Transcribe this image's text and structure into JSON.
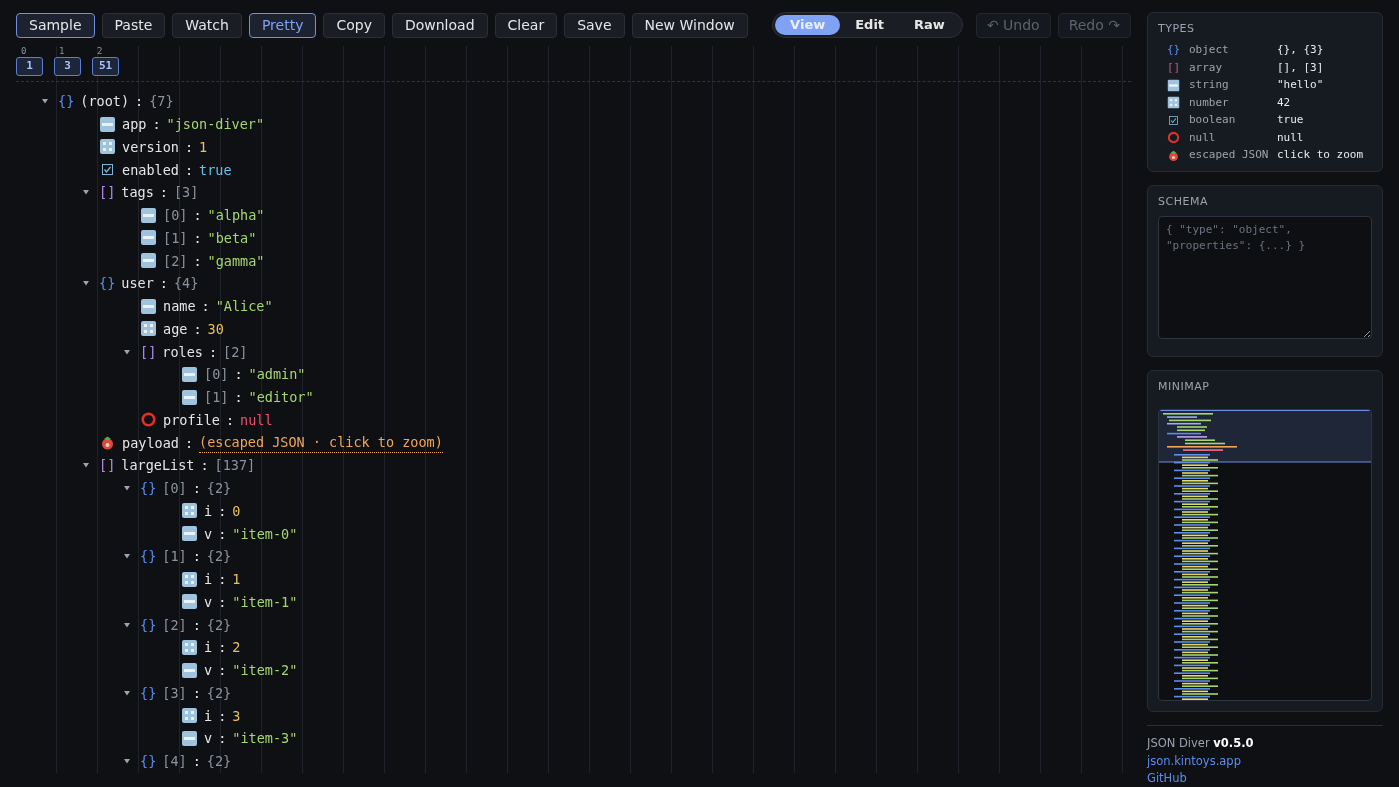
{
  "toolbar": {
    "buttons": [
      {
        "label": "Sample",
        "kind": "outlined"
      },
      {
        "label": "Paste",
        "kind": "plain"
      },
      {
        "label": "Watch",
        "kind": "plain"
      },
      {
        "label": "Pretty",
        "kind": "toggled"
      },
      {
        "label": "Copy",
        "kind": "plain"
      },
      {
        "label": "Download",
        "kind": "plain"
      },
      {
        "label": "Clear",
        "kind": "plain"
      },
      {
        "label": "Save",
        "kind": "plain"
      },
      {
        "label": "New Window",
        "kind": "plain"
      }
    ],
    "modes": [
      {
        "label": "View",
        "selected": true
      },
      {
        "label": "Edit",
        "selected": false
      },
      {
        "label": "Raw",
        "selected": false
      }
    ],
    "history": [
      {
        "label": "↶ Undo",
        "disabled": true
      },
      {
        "label": "Redo ↷",
        "disabled": true
      }
    ]
  },
  "depth_columns": [
    {
      "index": "0",
      "value": "1"
    },
    {
      "index": "1",
      "value": "3"
    },
    {
      "index": "2",
      "value": "51"
    }
  ],
  "tree": {
    "separator": ":",
    "root": {
      "kind": "object",
      "glyph": "{}",
      "key": "(root)",
      "count": "{7}",
      "expanded": true,
      "children": [
        {
          "kind": "string",
          "key": "app",
          "value": "\"json-diver\""
        },
        {
          "kind": "number",
          "key": "version",
          "value": "1"
        },
        {
          "kind": "boolean",
          "key": "enabled",
          "value": "true"
        },
        {
          "kind": "array",
          "glyph": "[]",
          "key": "tags",
          "count": "[3]",
          "expanded": true,
          "children": [
            {
              "kind": "string",
              "key": "[0]",
              "value": "\"alpha\""
            },
            {
              "kind": "string",
              "key": "[1]",
              "value": "\"beta\""
            },
            {
              "kind": "string",
              "key": "[2]",
              "value": "\"gamma\""
            }
          ]
        },
        {
          "kind": "object",
          "glyph": "{}",
          "key": "user",
          "count": "{4}",
          "expanded": true,
          "children": [
            {
              "kind": "string",
              "key": "name",
              "value": "\"Alice\""
            },
            {
              "kind": "number",
              "key": "age",
              "value": "30"
            },
            {
              "kind": "array",
              "glyph": "[]",
              "key": "roles",
              "count": "[2]",
              "expanded": true,
              "children": [
                {
                  "kind": "string",
                  "key": "[0]",
                  "value": "\"admin\""
                },
                {
                  "kind": "string",
                  "key": "[1]",
                  "value": "\"editor\""
                }
              ]
            },
            {
              "kind": "null",
              "key": "profile",
              "value": "null"
            }
          ]
        },
        {
          "kind": "escaped",
          "key": "payload",
          "value": "(escaped JSON · click to zoom)"
        },
        {
          "kind": "array",
          "glyph": "[]",
          "key": "largeList",
          "count": "[137]",
          "expanded": true,
          "children": [
            {
              "kind": "object",
              "glyph": "{}",
              "key": "[0]",
              "count": "{2}",
              "expanded": true,
              "children": [
                {
                  "kind": "number",
                  "key": "i",
                  "value": "0"
                },
                {
                  "kind": "string",
                  "key": "v",
                  "value": "\"item-0\""
                }
              ]
            },
            {
              "kind": "object",
              "glyph": "{}",
              "key": "[1]",
              "count": "{2}",
              "expanded": true,
              "children": [
                {
                  "kind": "number",
                  "key": "i",
                  "value": "1"
                },
                {
                  "kind": "string",
                  "key": "v",
                  "value": "\"item-1\""
                }
              ]
            },
            {
              "kind": "object",
              "glyph": "{}",
              "key": "[2]",
              "count": "{2}",
              "expanded": true,
              "children": [
                {
                  "kind": "number",
                  "key": "i",
                  "value": "2"
                },
                {
                  "kind": "string",
                  "key": "v",
                  "value": "\"item-2\""
                }
              ]
            },
            {
              "kind": "object",
              "glyph": "{}",
              "key": "[3]",
              "count": "{2}",
              "expanded": true,
              "children": [
                {
                  "kind": "number",
                  "key": "i",
                  "value": "3"
                },
                {
                  "kind": "string",
                  "key": "v",
                  "value": "\"item-3\""
                }
              ]
            },
            {
              "kind": "object",
              "glyph": "{}",
              "key": "[4]",
              "count": "{2}",
              "expanded": true
            }
          ]
        }
      ]
    }
  },
  "types_panel": {
    "title": "TYPES",
    "items": [
      {
        "kind": "object",
        "glyph": "{}",
        "name": "object",
        "example": "{}, {3}"
      },
      {
        "kind": "array",
        "glyph": "[]",
        "name": "array",
        "example": "[], [3]"
      },
      {
        "kind": "string",
        "name": "string",
        "example": "\"hello\""
      },
      {
        "kind": "number",
        "name": "number",
        "example": "42"
      },
      {
        "kind": "boolean",
        "name": "boolean",
        "example": "true"
      },
      {
        "kind": "null",
        "name": "null",
        "example": "null"
      },
      {
        "kind": "escaped",
        "name": "escaped JSON",
        "example": "click to zoom"
      }
    ]
  },
  "schema_panel": {
    "title": "SCHEMA",
    "placeholder": "{ \"type\": \"object\", \"properties\": {...} }"
  },
  "minimap_panel": {
    "title": "MINIMAP"
  },
  "footer": {
    "version": "JSON Diver **v0.5.0**",
    "links": [
      "json.kintoys.app",
      "GitHub"
    ]
  }
}
